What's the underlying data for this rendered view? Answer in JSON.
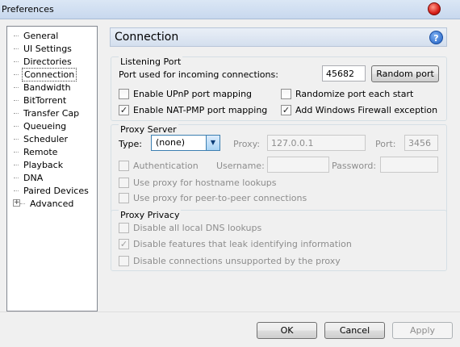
{
  "window": {
    "title": "Preferences"
  },
  "sidebar": {
    "items": [
      {
        "label": "General"
      },
      {
        "label": "UI Settings"
      },
      {
        "label": "Directories"
      },
      {
        "label": "Connection"
      },
      {
        "label": "Bandwidth"
      },
      {
        "label": "BitTorrent"
      },
      {
        "label": "Transfer Cap"
      },
      {
        "label": "Queueing"
      },
      {
        "label": "Scheduler"
      },
      {
        "label": "Remote"
      },
      {
        "label": "Playback"
      },
      {
        "label": "DNA"
      },
      {
        "label": "Paired Devices"
      },
      {
        "label": "Advanced",
        "expander": "+"
      }
    ]
  },
  "page": {
    "title": "Connection",
    "help_icon": "?"
  },
  "listening_port": {
    "title": "Listening Port",
    "port_label": "Port used for incoming connections:",
    "port_value": "45682",
    "random_port_button": "Random port",
    "upnp": {
      "label": "Enable UPnP port mapping",
      "checked": ""
    },
    "randomize": {
      "label": "Randomize port each start",
      "checked": ""
    },
    "natpmp": {
      "label": "Enable NAT-PMP port mapping",
      "checked": "✓"
    },
    "firewall": {
      "label": "Add Windows Firewall exception",
      "checked": "✓"
    }
  },
  "proxy_server": {
    "title": "Proxy Server",
    "type_label": "Type:",
    "type_value": "(none)",
    "proxy_label": "Proxy:",
    "proxy_value": "127.0.0.1",
    "port_label": "Port:",
    "port_value": "3456",
    "auth": {
      "label": "Authentication",
      "checked": ""
    },
    "username_label": "Username:",
    "password_label": "Password:",
    "hostname_lookups": {
      "label": "Use proxy for hostname lookups",
      "checked": ""
    },
    "p2p": {
      "label": "Use proxy for peer-to-peer connections",
      "checked": ""
    }
  },
  "proxy_privacy": {
    "title": "Proxy Privacy",
    "dns": {
      "label": "Disable all local DNS lookups",
      "checked": ""
    },
    "leak": {
      "label": "Disable features that leak identifying information",
      "checked": "✓"
    },
    "unsupported": {
      "label": "Disable connections unsupported by the proxy",
      "checked": ""
    }
  },
  "footer": {
    "ok_button": "OK",
    "cancel_button": "Cancel",
    "apply_button": "Apply"
  }
}
